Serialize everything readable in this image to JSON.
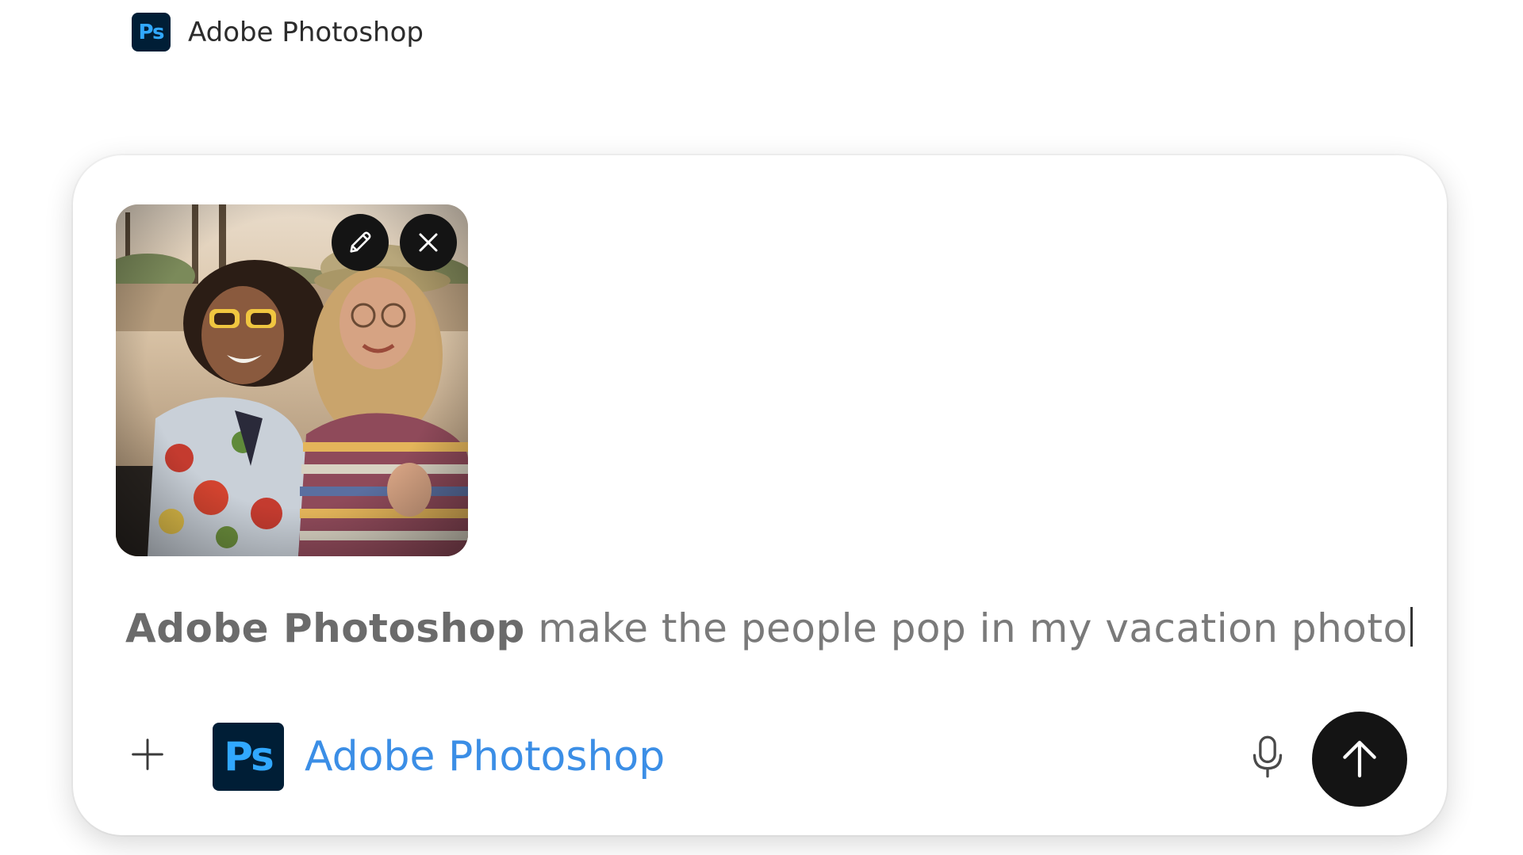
{
  "header": {
    "logo_text": "Ps",
    "title": "Adobe Photoshop"
  },
  "composer": {
    "attachment": {
      "edit_icon": "pencil-icon",
      "remove_icon": "close-icon"
    },
    "prompt": {
      "mention": "Adobe Photoshop",
      "text": " make the people pop in my vacation photo"
    },
    "toolbar": {
      "add_icon": "plus-icon",
      "app_logo_text": "Ps",
      "app_label": "Adobe Photoshop",
      "mic_icon": "microphone-icon",
      "send_icon": "arrow-up-icon"
    }
  },
  "colors": {
    "ps_dark": "#001e36",
    "ps_blue": "#31a8ff",
    "link_blue": "#3b8ee6",
    "send_black": "#141414"
  }
}
